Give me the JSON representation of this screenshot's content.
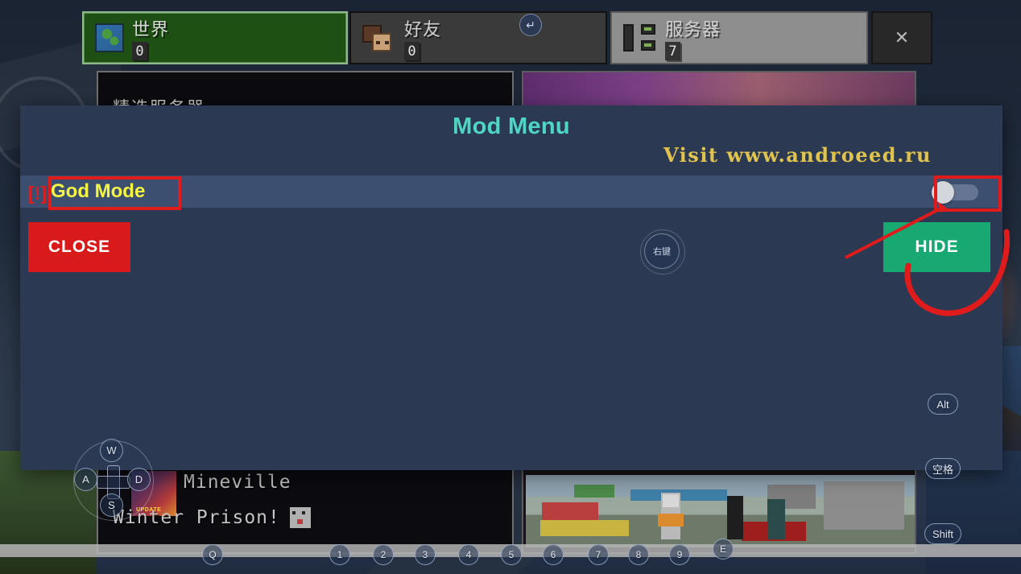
{
  "game": {
    "tabs": [
      {
        "id": "world",
        "label": "世界",
        "count": "0",
        "icon": "globe-icon",
        "active": true
      },
      {
        "id": "friends",
        "label": "好友",
        "count": "0",
        "icon": "friends-icon",
        "active": false
      },
      {
        "id": "servers",
        "label": "服务器",
        "count": "7",
        "icon": "server-icon",
        "active": false
      }
    ],
    "close_label": "✕",
    "featured_servers_title": "精选服务器",
    "server": {
      "name": "Mineville",
      "motd": "Winter Prison!",
      "thumb_badge": "UPDATE"
    },
    "controls": {
      "dpad": [
        "W",
        "A",
        "S",
        "D"
      ],
      "right_click_label": "右键",
      "enter_label": "↵",
      "hotbar": [
        "Q",
        "1",
        "2",
        "3",
        "4",
        "5",
        "6",
        "7",
        "8",
        "9",
        "E"
      ],
      "side_keys": [
        "Alt",
        "空格",
        "Shift"
      ]
    }
  },
  "mod_menu": {
    "title": "Mod Menu",
    "visit_text": "Visit www.androeed.ru",
    "warning_marker": "[!]",
    "options": [
      {
        "label": "God Mode",
        "enabled": false
      }
    ],
    "close_label": "CLOSE",
    "hide_label": "HIDE",
    "colors": {
      "panel": "#2b3a52",
      "row": "#3c4f70",
      "title": "#4fd6c3",
      "visit": "#e0c24e",
      "option_label": "#f5f542",
      "close": "#d91a1a",
      "hide": "#17a971",
      "annotation": "#e01b1b"
    }
  }
}
